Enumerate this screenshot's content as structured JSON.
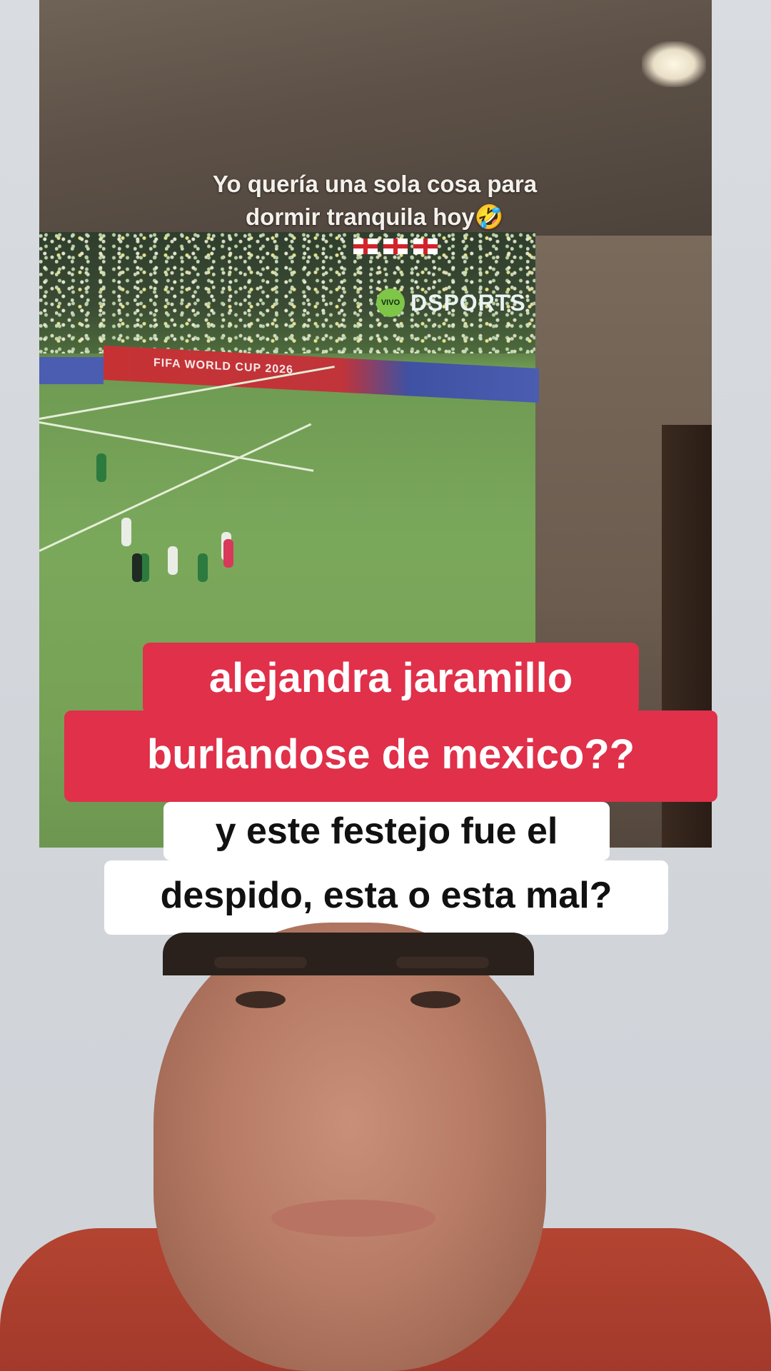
{
  "embedded_video": {
    "caption_line1": "Yo quería una sola cosa para",
    "caption_line2": "dormir tranquila hoy🤣",
    "live_badge": "VIVO",
    "broadcaster": "DSPORTS",
    "ad_board_text": "FIFA WORLD CUP 2026"
  },
  "captions": {
    "red_line1": "alejandra jaramillo",
    "red_line2": "burlandose de mexico??",
    "white_line1": "y este festejo fue el",
    "white_line2": "despido, esta o esta mal?"
  },
  "colors": {
    "red_caption_bg": "#e0304a",
    "white_caption_bg": "#ffffff"
  }
}
